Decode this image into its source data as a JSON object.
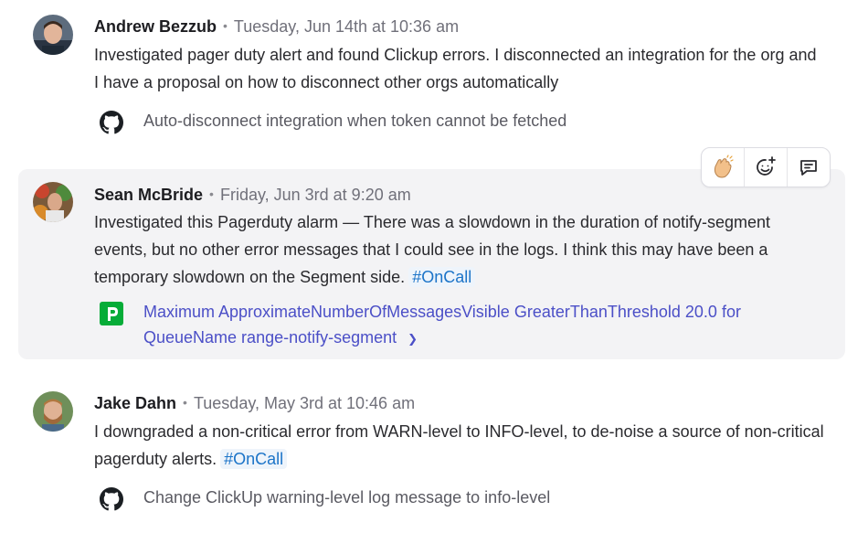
{
  "posts": [
    {
      "author": "Andrew Bezzub",
      "timestamp": "Tuesday, Jun 14th at 10:36 am",
      "text": "Investigated pager duty alert and found Clickup errors. I disconnected an integration for the org and I have a proposal on how to disconnect other orgs automatically",
      "tag": "",
      "attachment": {
        "icon": "github-icon",
        "label": "Auto-disconnect integration when token cannot be fetched"
      }
    },
    {
      "author": "Sean McBride",
      "timestamp": "Friday, Jun 3rd at 9:20 am",
      "text": "Investigated this Pagerduty alarm — There was a slowdown in the duration of notify-segment events, but no other error messages that I could see in the logs. I think this may have been a temporary slowdown on the Segment side.",
      "tag": "#OnCall",
      "attachment": {
        "icon": "pagerduty-icon",
        "label": "Maximum ApproximateNumberOfMessagesVisible GreaterThanThreshold 20.0 for QueueName range-notify-segment"
      }
    },
    {
      "author": "Jake Dahn",
      "timestamp": "Tuesday, May 3rd at 10:46 am",
      "text": "I downgraded a non-critical error from WARN-level to INFO-level, to de-noise a source of non-critical pagerduty alerts.",
      "tag": "#OnCall",
      "attachment": {
        "icon": "github-icon",
        "label": "Change ClickUp warning-level log message to info-level"
      }
    }
  ],
  "separator": "•",
  "reaction_bar": {
    "icons": [
      "clapping-hands-icon",
      "add-reaction-icon",
      "reply-icon"
    ]
  },
  "colors": {
    "highlight_bg": "#f3f3f5",
    "tag": "#1c74c8",
    "link": "#4b4fc7",
    "pagerduty": "#06ac38"
  }
}
